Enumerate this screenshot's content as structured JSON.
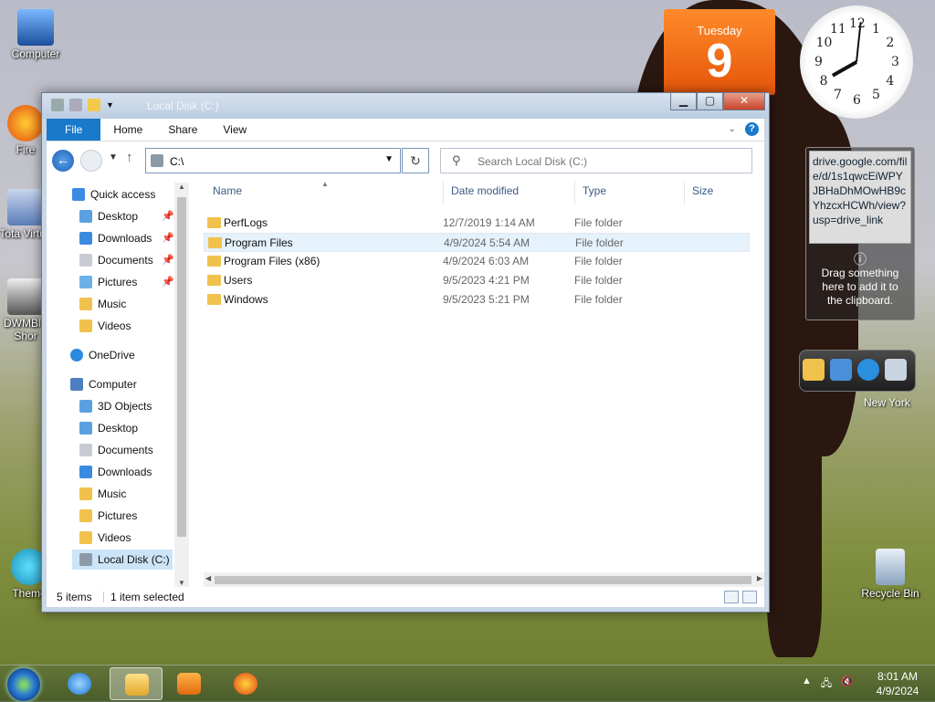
{
  "desktop": {
    "icons": [
      {
        "label": "Computer"
      },
      {
        "label": "Fire"
      },
      {
        "label": "Tota Virtua"
      },
      {
        "label": "DWMBl - Shor"
      },
      {
        "label": "Theme"
      },
      {
        "label": "Recycle Bin"
      }
    ]
  },
  "gadgets": {
    "calendar": {
      "day_name": "Tuesday",
      "day_number": "9"
    },
    "clock": {
      "numerals": [
        "12",
        "1",
        "2",
        "3",
        "4",
        "5",
        "6",
        "7",
        "8",
        "9",
        "10",
        "11"
      ],
      "hour": 8,
      "minute": 1
    },
    "clipboard": {
      "link": "drive.google.com/file/d/1s1qwcEiWPYJBHaDhMOwHB9cYhzcxHCWh/view?usp=drive_link",
      "message": "Drag something here to add it to the clipboard."
    },
    "weather": {
      "city": "New York"
    }
  },
  "window": {
    "title": "Local Disk (C:)",
    "buttons": {
      "minimize": "▁",
      "maximize": "▢",
      "close": "✕"
    },
    "ribbon": {
      "tabs": [
        "File",
        "Home",
        "Share",
        "View"
      ]
    },
    "address": {
      "value": "C:\\"
    },
    "search": {
      "placeholder": "Search Local Disk (C:)"
    },
    "nav": {
      "quick_access": "Quick access",
      "quick_items": [
        "Desktop",
        "Downloads",
        "Documents",
        "Pictures",
        "Music",
        "Videos"
      ],
      "onedrive": "OneDrive",
      "computer": "Computer",
      "computer_items": [
        "3D Objects",
        "Desktop",
        "Documents",
        "Downloads",
        "Music",
        "Pictures",
        "Videos",
        "Local Disk (C:)"
      ]
    },
    "columns": {
      "name": "Name",
      "date": "Date modified",
      "type": "Type",
      "size": "Size"
    },
    "files": [
      {
        "name": "PerfLogs",
        "date": "12/7/2019 1:14 AM",
        "type": "File folder"
      },
      {
        "name": "Program Files",
        "date": "4/9/2024 5:54 AM",
        "type": "File folder"
      },
      {
        "name": "Program Files (x86)",
        "date": "4/9/2024 6:03 AM",
        "type": "File folder"
      },
      {
        "name": "Users",
        "date": "9/5/2023 4:21 PM",
        "type": "File folder"
      },
      {
        "name": "Windows",
        "date": "9/5/2023 5:21 PM",
        "type": "File folder"
      }
    ],
    "status": {
      "items": "5 items",
      "selected": "1 item selected"
    }
  },
  "taskbar": {
    "time": "8:01 AM",
    "date": "4/9/2024"
  },
  "colors": {
    "accent": "#1979ca",
    "folder": "#f0c24c",
    "calendar": "#e5560a"
  }
}
